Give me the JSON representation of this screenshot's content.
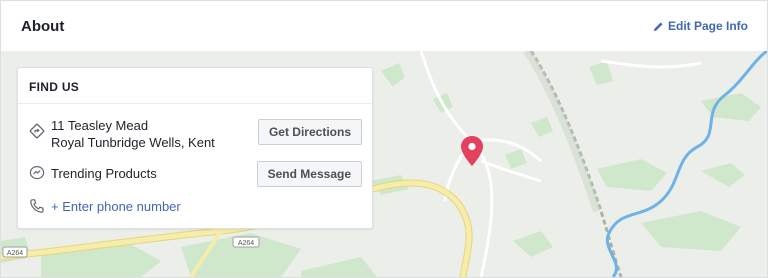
{
  "header": {
    "title": "About",
    "edit_label": "Edit Page Info"
  },
  "card": {
    "title": "FIND US",
    "address_line1": "11 Teasley Mead",
    "address_line2": "Royal Tunbridge Wells, Kent",
    "directions_label": "Get Directions",
    "messenger_label": "Trending Products",
    "send_message_label": "Send Message",
    "phone_label": "+ Enter phone number"
  },
  "map": {
    "road_labels": [
      "A264",
      "A264"
    ],
    "pin_color": "#e4405f",
    "road_color": "#f3e9a6",
    "water_color": "#6ab0e6",
    "park_color": "#c9e6c5"
  },
  "colors": {
    "link": "#4267b2",
    "text": "#1d2129",
    "border": "#dddfe2"
  }
}
